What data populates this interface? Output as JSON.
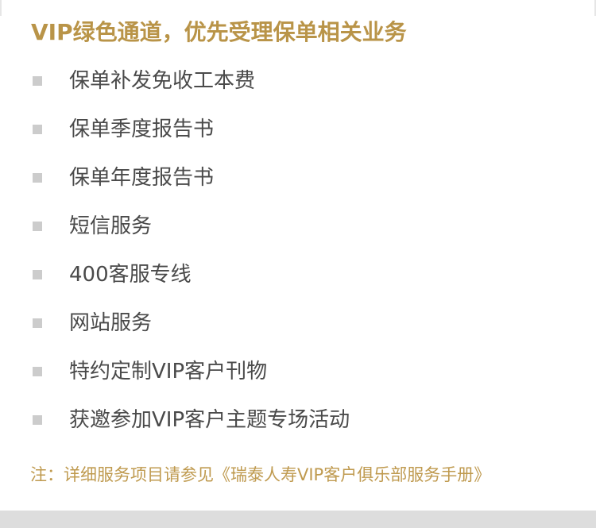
{
  "title": "VIP绿色通道，优先受理保单相关业务",
  "items": [
    {
      "label": "保单补发免收工本费"
    },
    {
      "label": "保单季度报告书"
    },
    {
      "label": "保单年度报告书"
    },
    {
      "label": "短信服务"
    },
    {
      "label": "400客服专线"
    },
    {
      "label": "网站服务"
    },
    {
      "label": "特约定制VIP客户刊物"
    },
    {
      "label": "获邀参加VIP客户主题专场活动"
    }
  ],
  "note": "注：详细服务项目请参见《瑞泰人寿VIP客户俱乐部服务手册》",
  "colors": {
    "accent": "#b99448",
    "text": "#4a4a4a",
    "bullet": "#cccccc",
    "footer_bar": "#dddddd"
  }
}
